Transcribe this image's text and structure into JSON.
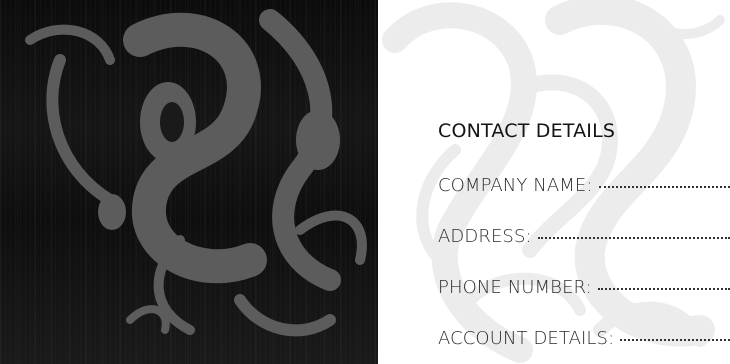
{
  "background": {
    "panel_color": "#111111",
    "ornament_dark_color": "#5a5a5a",
    "ornament_light_color": "#eeeeee",
    "ornament_icon": "decorative-flourish"
  },
  "contact": {
    "heading": "CONTACT DETAILS",
    "fields": [
      {
        "label": "COMPANY NAME:"
      },
      {
        "label": "ADDRESS:"
      },
      {
        "label": "PHONE NUMBER:"
      },
      {
        "label": "ACCOUNT DETAILS:"
      }
    ]
  }
}
